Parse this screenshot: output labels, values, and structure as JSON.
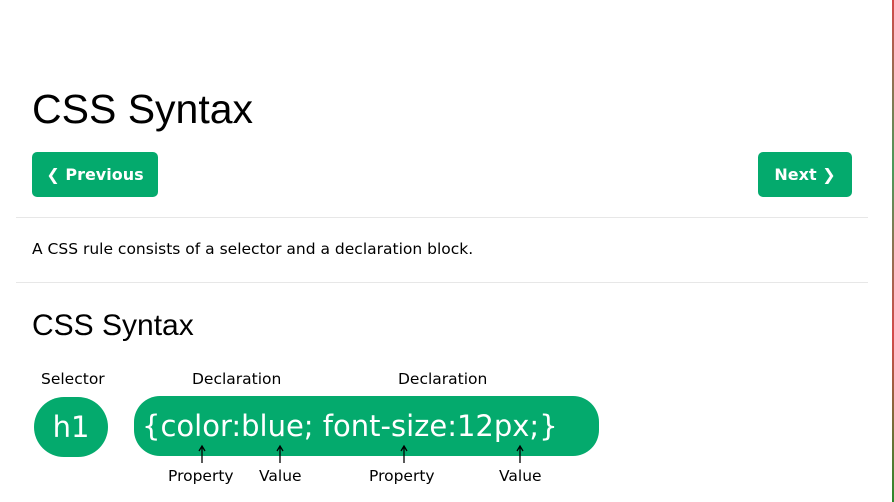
{
  "page": {
    "title": "CSS Syntax",
    "prev_label": "❮ Previous",
    "next_label": "Next ❯",
    "intro": "A CSS rule consists of a selector and a declaration block.",
    "section_title": "CSS Syntax"
  },
  "diagram": {
    "selector_label": "Selector",
    "declaration_label_1": "Declaration",
    "declaration_label_2": "Declaration",
    "selector_code": "h1",
    "declaration_code": "{color:blue; font-size:12px;}",
    "property_label_1": "Property",
    "value_label_1": "Value",
    "property_label_2": "Property",
    "value_label_2": "Value"
  },
  "colors": {
    "accent": "#04aa6d",
    "divider": "#e7e7e7"
  }
}
